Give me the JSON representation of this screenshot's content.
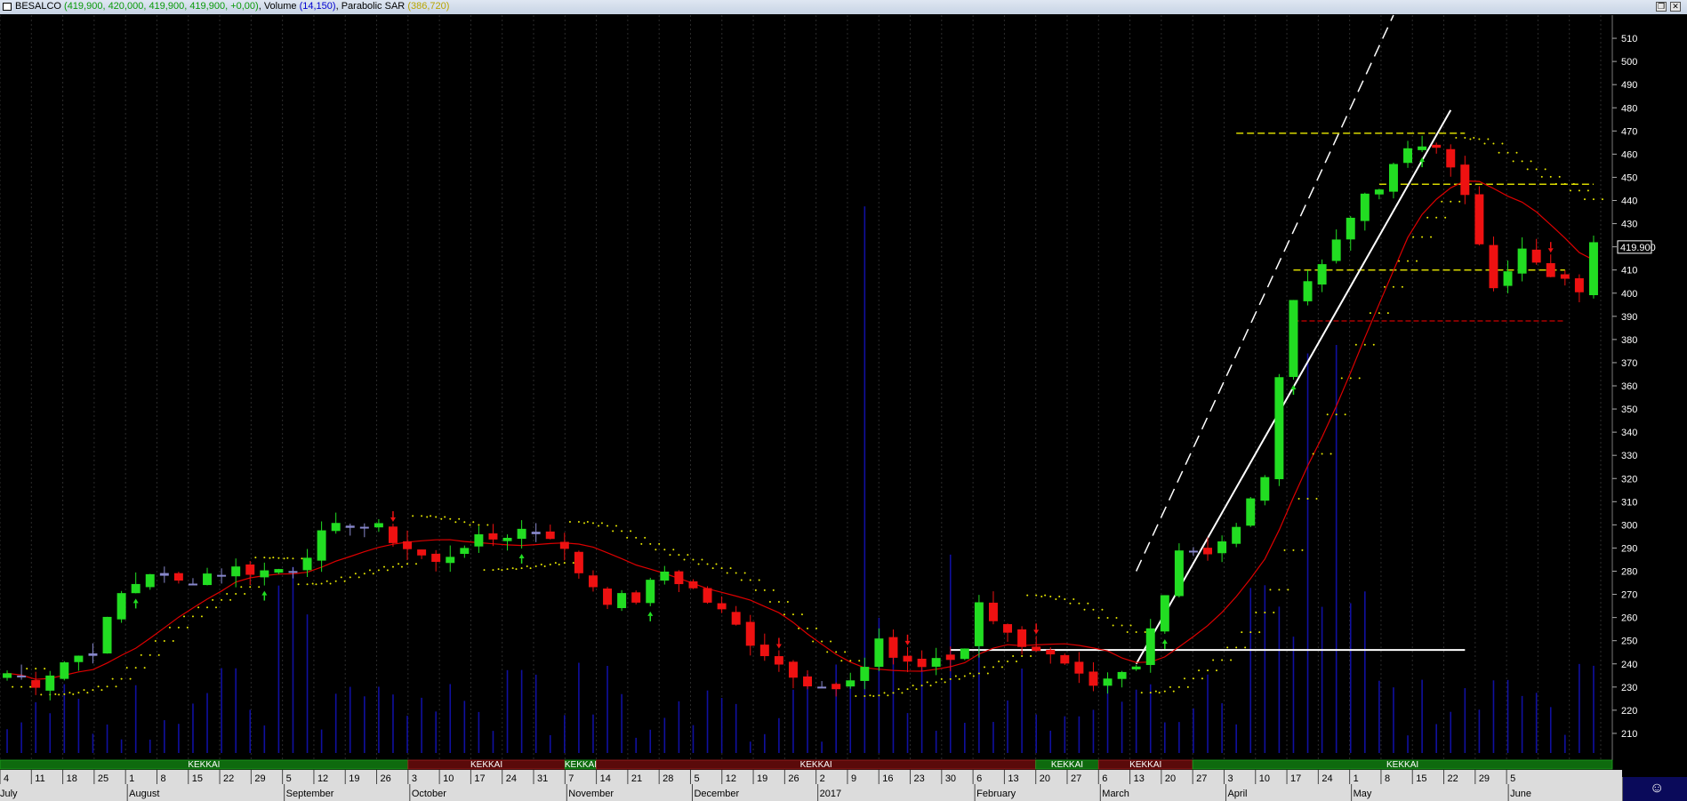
{
  "window": {
    "ticker": "BESALCO",
    "ohlc_text": "(419,900, 420,000, 419,900, 419,900, +0,00)",
    "volume_label": "Volume",
    "volume_value": "(14,150)",
    "psar_label": "Parabolic SAR",
    "psar_value": "(386,720)",
    "restore_glyph": "❐",
    "close_glyph": "✕"
  },
  "colors": {
    "background": "#000000",
    "bull": "#22dd22",
    "bear": "#ee1111",
    "neutral": "#8888cc",
    "volume": "#1010a0",
    "ma": "#dd0000",
    "psar": "#e8e800",
    "trendline": "#ffffff",
    "level_yellow": "#d8d800",
    "level_red": "#cc0000",
    "axis_text": "#ffffff"
  },
  "status": {
    "smiley_icon": "smiley-face-icon",
    "smiley_glyph": "☺"
  },
  "chart_data": {
    "type": "candlestick",
    "title": "BESALCO",
    "ylim": [
      200,
      520
    ],
    "yticks": [
      210,
      220,
      230,
      240,
      250,
      260,
      270,
      280,
      290,
      300,
      310,
      320,
      330,
      340,
      350,
      360,
      370,
      380,
      390,
      400,
      410,
      420,
      430,
      440,
      450,
      460,
      470,
      480,
      490,
      500,
      510
    ],
    "last_price_label": "419.900",
    "last_price": 419.9,
    "day_labels": [
      "4",
      "11",
      "18",
      "25",
      "1",
      "8",
      "15",
      "22",
      "29",
      "5",
      "12",
      "19",
      "26",
      "3",
      "10",
      "17",
      "24",
      "31",
      "7",
      "14",
      "21",
      "28",
      "5",
      "12",
      "19",
      "26",
      "2",
      "9",
      "16",
      "23",
      "30",
      "6",
      "13",
      "20",
      "27",
      "6",
      "13",
      "20",
      "27",
      "3",
      "10",
      "17",
      "24",
      "1",
      "8",
      "15",
      "22",
      "29",
      "5"
    ],
    "month_labels": [
      "July",
      "August",
      "September",
      "October",
      "November",
      "December",
      "2017",
      "February",
      "March",
      "April",
      "May",
      "June"
    ],
    "month_start_week": [
      0,
      4,
      9,
      13,
      18,
      22,
      26,
      31,
      35,
      39,
      43,
      48
    ],
    "weeks_total": 51,
    "kekkai": [
      {
        "label": "KEKKAI",
        "from": 0,
        "to": 13,
        "style": "green"
      },
      {
        "label": "KEKKAI",
        "from": 13,
        "to": 18,
        "style": "red"
      },
      {
        "label": "KEKKAI",
        "from": 18,
        "to": 19,
        "style": "green"
      },
      {
        "label": "KEKKAI",
        "from": 19,
        "to": 33,
        "style": "red"
      },
      {
        "label": "KEKKAI",
        "from": 33,
        "to": 35,
        "style": "green"
      },
      {
        "label": "KEKKAI",
        "from": 35,
        "to": 38,
        "style": "red"
      },
      {
        "label": "KEKKAI",
        "from": 38,
        "to": 53,
        "style": "green"
      }
    ],
    "close_path": [
      [
        0,
        236
      ],
      [
        2,
        232
      ],
      [
        4,
        241
      ],
      [
        6,
        246
      ],
      [
        8,
        270
      ],
      [
        10,
        280
      ],
      [
        12,
        275
      ],
      [
        14,
        279
      ],
      [
        16,
        281
      ],
      [
        18,
        280
      ],
      [
        20,
        282
      ],
      [
        22,
        295
      ],
      [
        24,
        301
      ],
      [
        26,
        298
      ],
      [
        28,
        290
      ],
      [
        30,
        283
      ],
      [
        32,
        292
      ],
      [
        34,
        294
      ],
      [
        36,
        298
      ],
      [
        38,
        296
      ],
      [
        40,
        280
      ],
      [
        42,
        268
      ],
      [
        44,
        268
      ],
      [
        46,
        280
      ],
      [
        48,
        272
      ],
      [
        50,
        262
      ],
      [
        52,
        250
      ],
      [
        54,
        240
      ],
      [
        56,
        233
      ],
      [
        58,
        228
      ],
      [
        60,
        236
      ],
      [
        61,
        252
      ],
      [
        62,
        243
      ],
      [
        64,
        239
      ],
      [
        66,
        242
      ],
      [
        67,
        247
      ],
      [
        68,
        268
      ],
      [
        70,
        252
      ],
      [
        72,
        247
      ],
      [
        74,
        238
      ],
      [
        76,
        228
      ],
      [
        78,
        235
      ],
      [
        79,
        238
      ],
      [
        80,
        255
      ],
      [
        82,
        290
      ],
      [
        84,
        289
      ],
      [
        86,
        298
      ],
      [
        88,
        322
      ],
      [
        90,
        400
      ],
      [
        92,
        412
      ],
      [
        94,
        435
      ],
      [
        96,
        445
      ],
      [
        98,
        462
      ],
      [
        100,
        465
      ],
      [
        102,
        440
      ],
      [
        104,
        405
      ],
      [
        106,
        418
      ],
      [
        108,
        406
      ],
      [
        110,
        402
      ],
      [
        111,
        420
      ]
    ],
    "resistance_level": 246,
    "yellow_levels": [
      469,
      447,
      410
    ],
    "red_level": 388
  }
}
